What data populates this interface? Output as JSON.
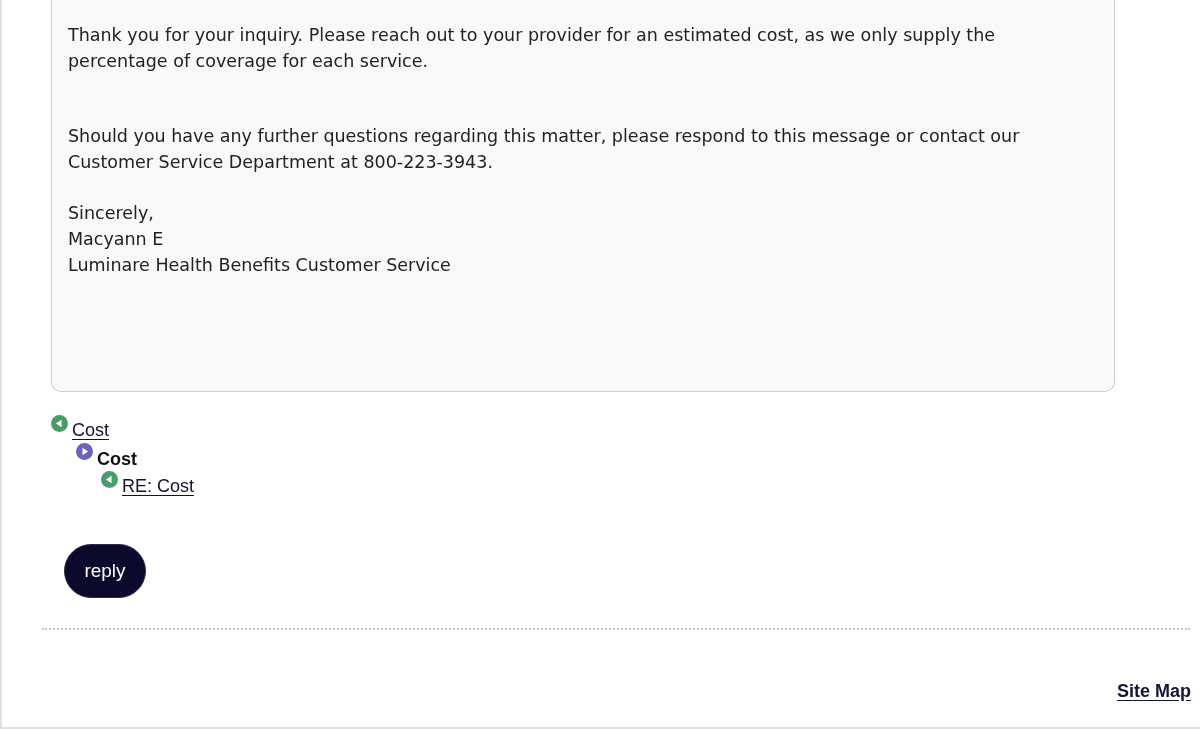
{
  "message": {
    "paragraphs": [
      "Thank you for your inquiry. Please reach out to your provider for an estimated cost, as we only supply the percentage of coverage for each service.",
      "Should you have any further questions regarding this matter, please respond to this message or contact our Customer Service Department at 800-223-3943."
    ],
    "signature": [
      "Sincerely,",
      "Macyann E",
      "Luminare Health Benefits Customer Service"
    ]
  },
  "thread": [
    {
      "title": "Cost",
      "selected": false,
      "children": [
        {
          "title": "Cost",
          "selected": true,
          "children": [
            {
              "title": "RE: Cost",
              "selected": false
            }
          ]
        }
      ]
    }
  ],
  "reply_button": {
    "label": "reply"
  },
  "footer": {
    "site_map": "Site Map"
  }
}
